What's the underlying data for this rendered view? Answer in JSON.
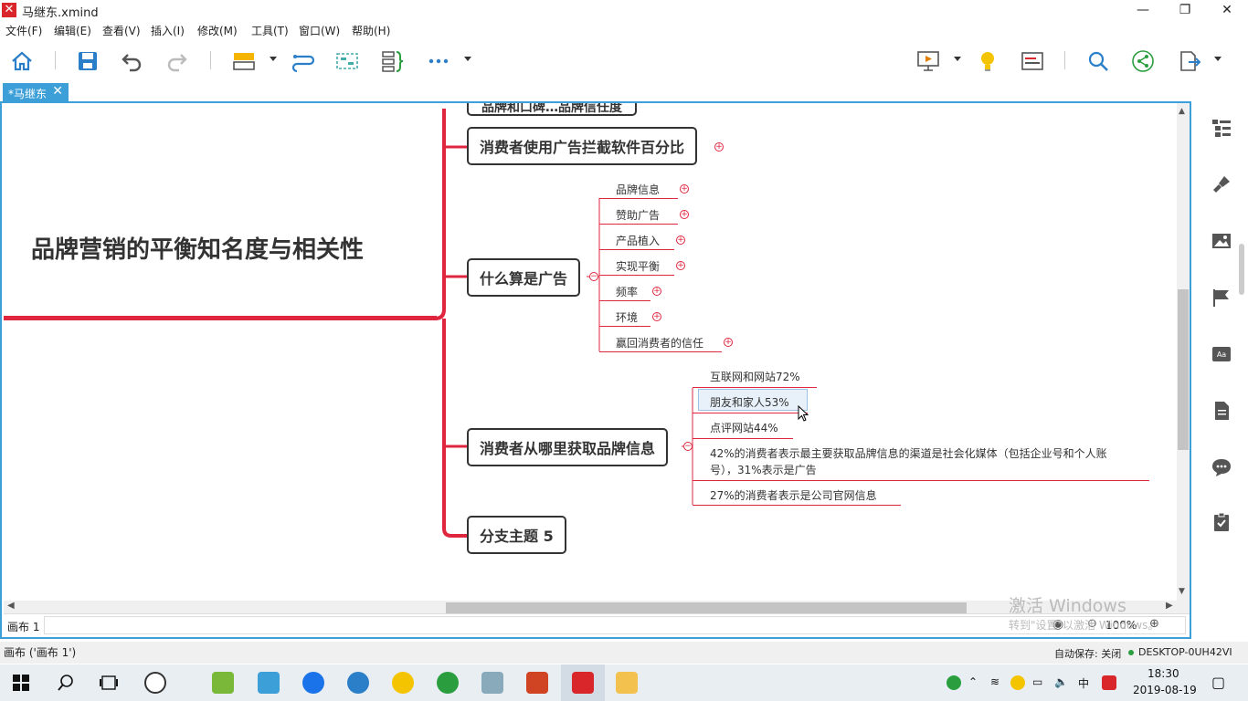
{
  "window": {
    "title": "马继东.xmind",
    "minimize": "—",
    "restore": "❐",
    "close": "✕"
  },
  "menu": [
    "文件(F)",
    "编辑(E)",
    "查看(V)",
    "插入(I)",
    "修改(M)",
    "工具(T)",
    "窗口(W)",
    "帮助(H)"
  ],
  "tab": {
    "label": "*马继东",
    "close": "✕"
  },
  "central_topic": "品牌营销的平衡知名度与相关性",
  "topics": {
    "partial_top": "品牌和口碑…品牌信任度",
    "ad_blocker": "消费者使用广告拦截软件百分比",
    "what_is_ad": "什么算是广告",
    "where_info": "消费者从哪里获取品牌信息",
    "branch5": "分支主题 5"
  },
  "ad_subtopics": [
    "品牌信息",
    "赞助广告",
    "产品植入",
    "实现平衡",
    "频率",
    "环境",
    "赢回消费者的信任"
  ],
  "info_subtopics": [
    "互联网和网站72%",
    "朋友和家人53%",
    "点评网站44%",
    "42%的消费者表示最主要获取品牌信息的渠道是社会化媒体（包括企业号和个人账",
    "号），31%表示是广告",
    "27%的消费者表示是公司官网信息"
  ],
  "canvas_tab": "画布 1",
  "zoom": "100%",
  "watermark": {
    "line1": "激活 Windows",
    "line2": "转到\"设置\"以激活 Windows。"
  },
  "status": {
    "left": "画布 ('画布 1')",
    "autosave": "自动保存: 关闭",
    "machine": "DESKTOP-0UH42VI"
  },
  "taskbar": {
    "time": "18:30",
    "date": "2019-08-19",
    "ime": "中"
  },
  "colors": {
    "accent": "#3d9fd8",
    "branch": "#e0263f"
  }
}
